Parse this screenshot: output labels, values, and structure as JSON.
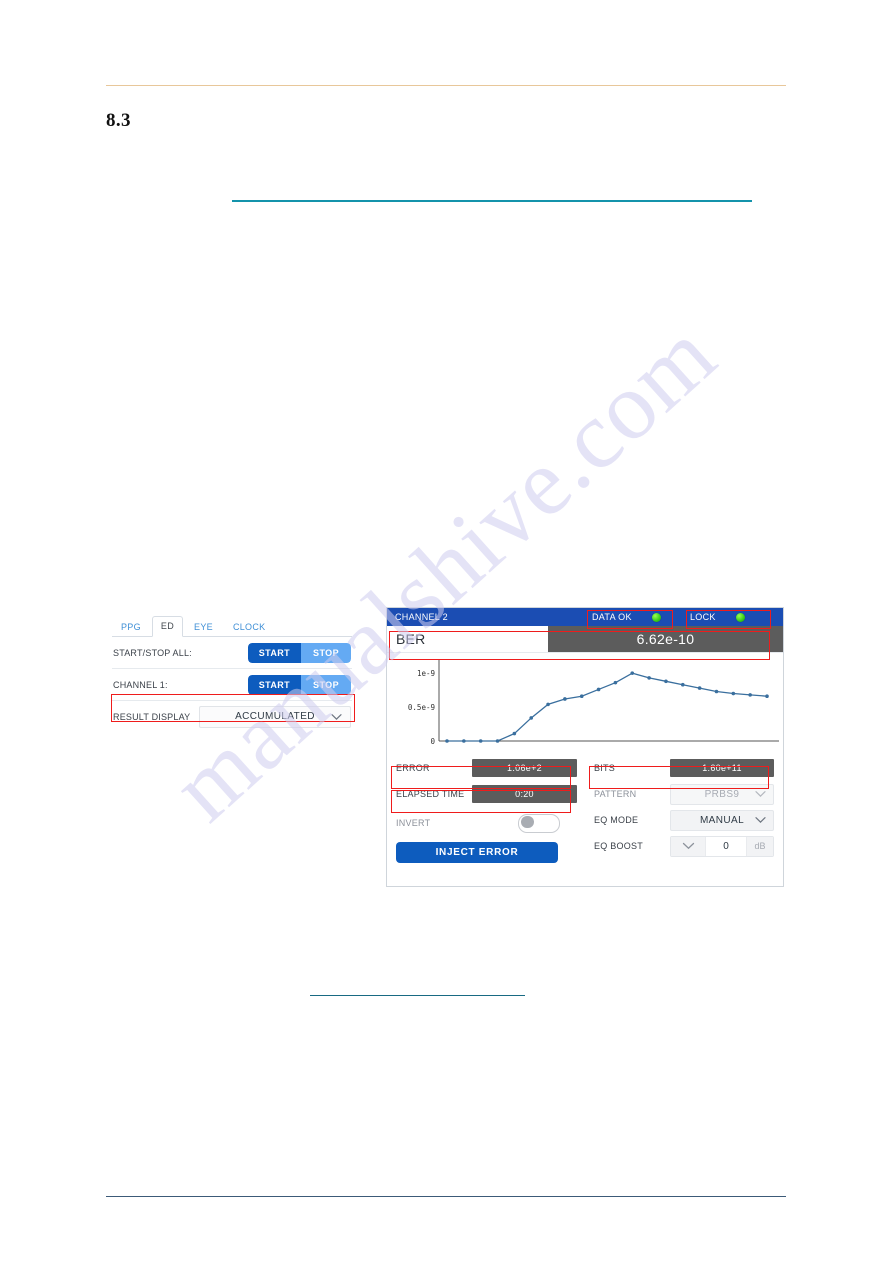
{
  "document": {
    "section_number": "8.3"
  },
  "watermark": {
    "text": "manualshive.com"
  },
  "left_panel": {
    "tabs": [
      {
        "label": "PPG",
        "active": false
      },
      {
        "label": "ED",
        "active": true
      },
      {
        "label": "EYE",
        "active": false
      },
      {
        "label": "CLOCK",
        "active": false
      }
    ],
    "rows": [
      {
        "label": "START/STOP ALL:",
        "start_label": "START",
        "stop_label": "STOP"
      },
      {
        "label": "CHANNEL 1:",
        "start_label": "START",
        "stop_label": "STOP"
      }
    ],
    "result_display": {
      "label": "RESULT DISPLAY",
      "value": "ACCUMULATED",
      "icon": "chevron-down-icon"
    }
  },
  "right_panel": {
    "title": "CHANNEL 2",
    "status": [
      {
        "label": "DATA OK",
        "led_color": "#34cc18"
      },
      {
        "label": "LOCK",
        "led_color": "#34cc18"
      }
    ],
    "ber": {
      "label": "BER",
      "value": "6.62e-10"
    },
    "readouts": {
      "error_label": "ERROR",
      "error_value": "1.06e+2",
      "bits_label": "BITS",
      "bits_value": "1.60e+11",
      "elapsed_label": "ELAPSED TIME",
      "elapsed_value": "0:20"
    },
    "pattern": {
      "label": "PATTERN",
      "value": "PRBS9",
      "icon": "chevron-down-icon"
    },
    "eq_mode": {
      "label": "EQ MODE",
      "value": "MANUAL",
      "icon": "chevron-down-icon"
    },
    "eq_boost": {
      "label": "EQ BOOST",
      "value": "0",
      "unit": "dB",
      "icon": "chevron-down-icon"
    },
    "invert": {
      "label": "INVERT",
      "state": "off"
    },
    "inject_error": {
      "label": "INJECT ERROR"
    }
  },
  "colors": {
    "titlebar_blue": "#1b4db3",
    "button_blue": "#0d5cbe",
    "button_light_blue": "#64aaf3",
    "readout_gray": "#5c5c5c",
    "annotation_red": "#ef1c1c",
    "rule_teal": "#1493ab",
    "rule_orange": "#e8c79a",
    "chart_line": "#3a6f9e"
  },
  "chart_data": {
    "type": "line",
    "title": "",
    "xlabel": "",
    "ylabel": "",
    "ylim": [
      0,
      1.15e-09
    ],
    "ytick_values": [
      0,
      5e-10,
      1e-09
    ],
    "ytick_labels": [
      "0",
      "0.5e-9",
      "1e-9"
    ],
    "grid": false,
    "legend": "none",
    "x": [
      1,
      2,
      3,
      4,
      5,
      6,
      7,
      8,
      9,
      10,
      11,
      12,
      13,
      14,
      15,
      16,
      17,
      18,
      19,
      20
    ],
    "values": [
      0,
      0,
      0,
      0,
      1.1e-10,
      3.4e-10,
      5.4e-10,
      6.2e-10,
      6.6e-10,
      7.6e-10,
      8.6e-10,
      1e-09,
      9.3e-10,
      8.8e-10,
      8.3e-10,
      7.8e-10,
      7.3e-10,
      7e-10,
      6.8e-10,
      6.6e-10
    ]
  },
  "annotations": [
    {
      "name": "result-display-highlight"
    },
    {
      "name": "data-ok-highlight"
    },
    {
      "name": "lock-highlight"
    },
    {
      "name": "ber-highlight"
    },
    {
      "name": "error-highlight"
    },
    {
      "name": "bits-highlight"
    },
    {
      "name": "elapsed-time-highlight"
    }
  ]
}
